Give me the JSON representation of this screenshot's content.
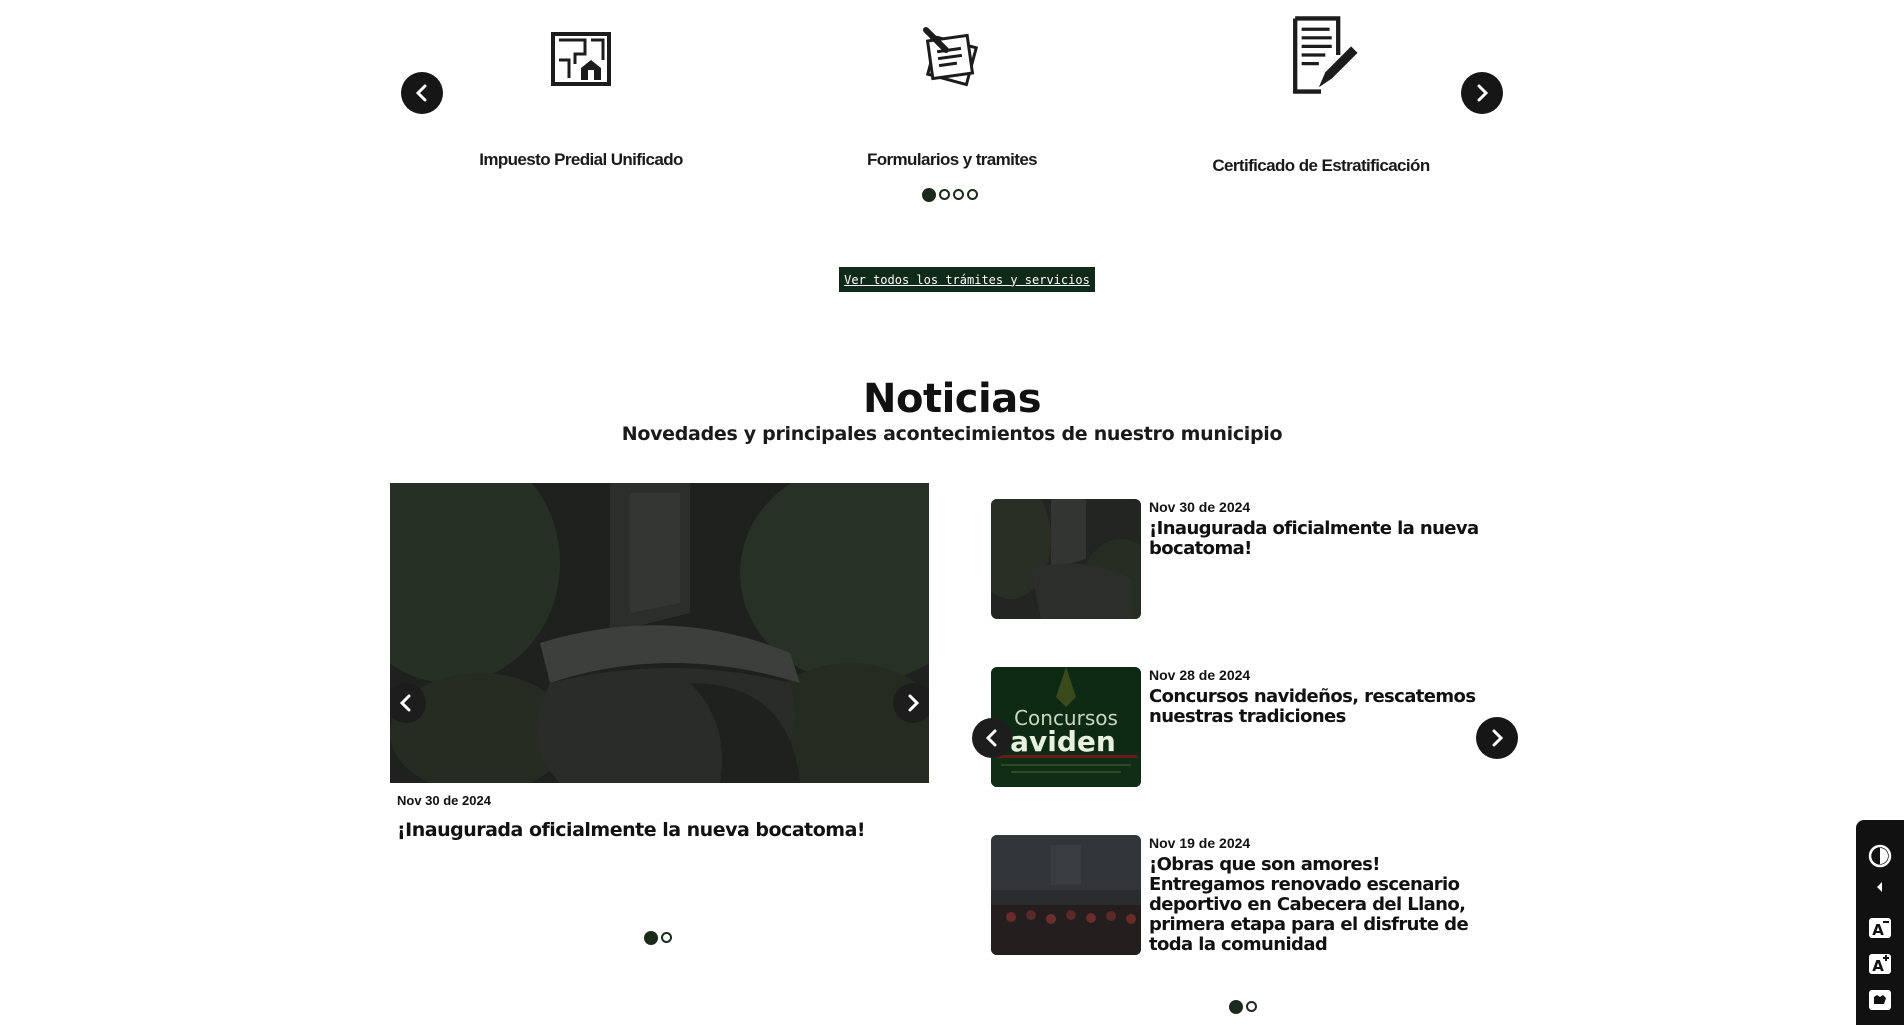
{
  "services": {
    "items": [
      {
        "label": "Impuesto Predial Unificado",
        "icon": "property-plan-icon"
      },
      {
        "label": "Formularios y tramites",
        "icon": "forms-pencil-icon"
      },
      {
        "label": "Certificado de Estratificación",
        "icon": "certificate-pen-icon"
      }
    ],
    "prev_icon": "chevron-left-icon",
    "next_icon": "chevron-right-icon",
    "page_count": 4,
    "active_page": 1,
    "cta_label": "Ver todos los trámites y servicios"
  },
  "news": {
    "title": "Noticias",
    "subtitle": "Novedades y principales acontecimientos de nuestro municipio",
    "featured": {
      "date": "Nov 30 de 2024",
      "headline": "¡Inaugurada oficialmente la nueva bocatoma!",
      "page_count": 2,
      "active_page": 1
    },
    "list": [
      {
        "date": "Nov 30 de 2024",
        "headline": "¡Inaugurada oficialmente la nueva bocatoma!"
      },
      {
        "date": "Nov 28 de 2024",
        "headline": "Concursos navideños, rescatemos nuestras tradiciones",
        "thumb_text_top": "Concursos",
        "thumb_text_big": "aviden"
      },
      {
        "date": "Nov 19 de 2024",
        "headline": "¡Obras que son amores! Entregamos renovado escenario deportivo en Cabecera del Llano, primera etapa para el disfrute de toda la comunidad"
      }
    ],
    "list_page_count": 2,
    "list_active_page": 1
  },
  "accessibility": {
    "buttons": [
      "contrast-icon",
      "collapse-arrow-icon",
      "decrease-font-icon",
      "increase-font-icon",
      "sign-language-icon"
    ]
  },
  "colors": {
    "brand_dark_green": "#0f2a18",
    "button_dark": "#161616"
  }
}
